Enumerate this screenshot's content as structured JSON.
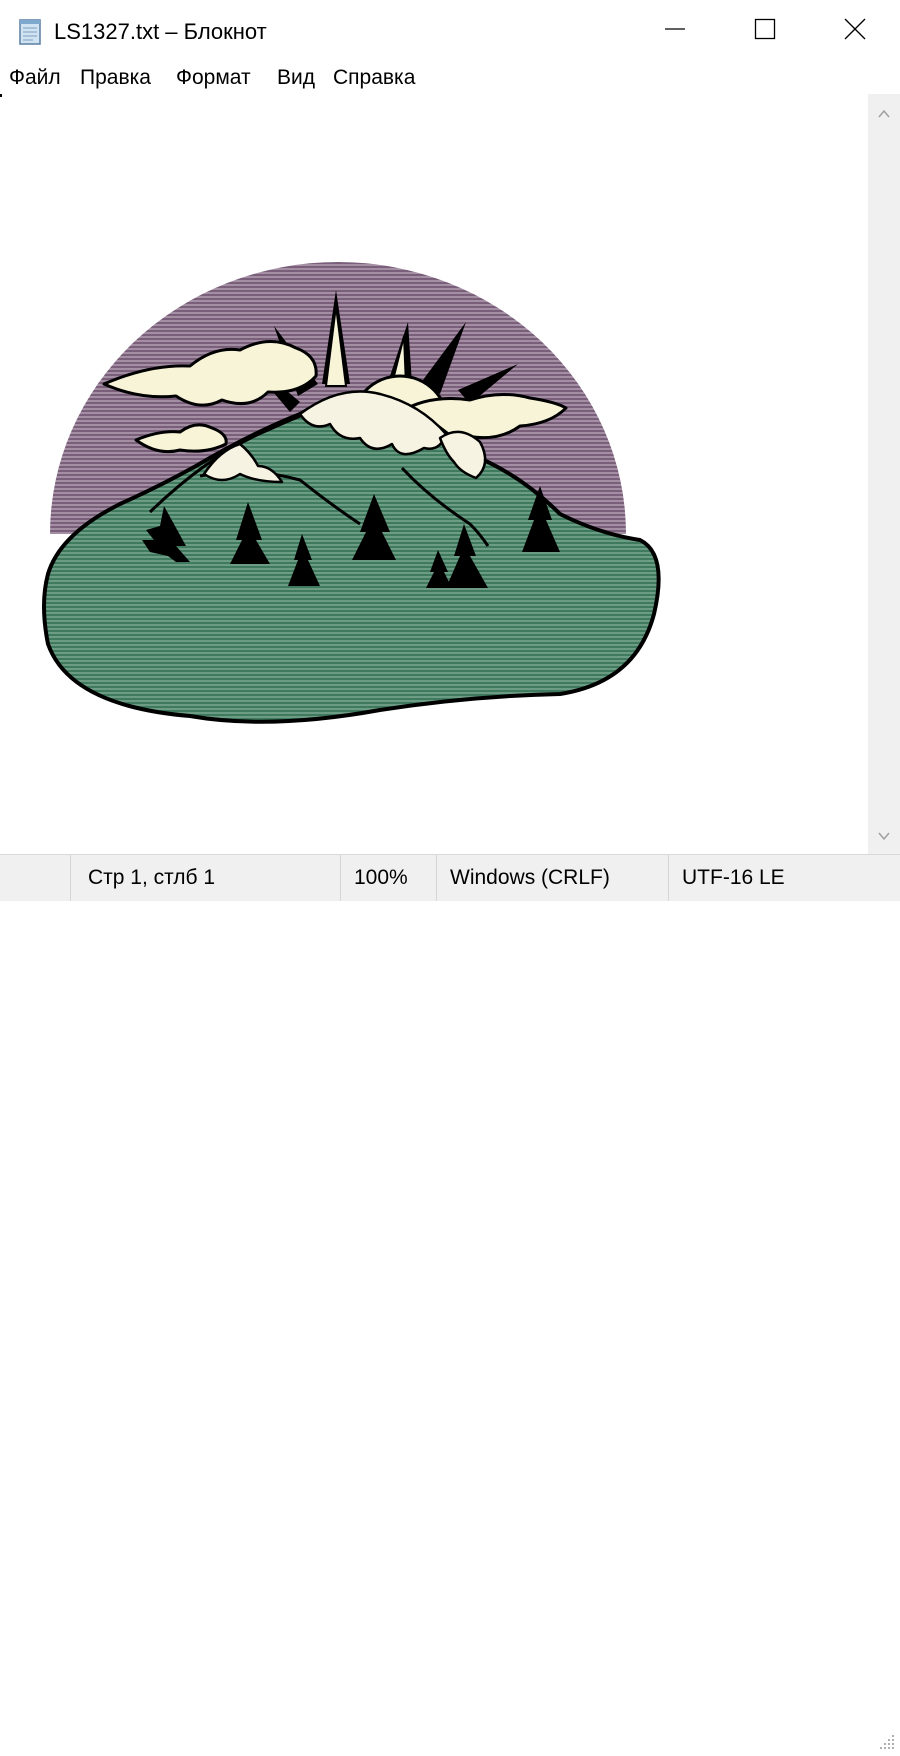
{
  "window": {
    "title": "LS1327.txt – Блокнот"
  },
  "menu": {
    "items": [
      "Файл",
      "Правка",
      "Формат",
      "Вид",
      "Справка"
    ]
  },
  "status": {
    "position": "Стр 1, стлб 1",
    "zoom": "100%",
    "line_endings": "Windows (CRLF)",
    "encoding": "UTF-16 LE"
  },
  "art": {
    "description_icon": "mountain-sun-clipart",
    "colors": {
      "sky": "#7a5f7a",
      "hill": "#3f7a5f",
      "outline": "#000000",
      "snow": "#f6f3e2",
      "sun": "#f8f4d8"
    }
  },
  "colors": {
    "statusbar": "#f0f0f0",
    "scrollbar": "#f0f0f0"
  }
}
